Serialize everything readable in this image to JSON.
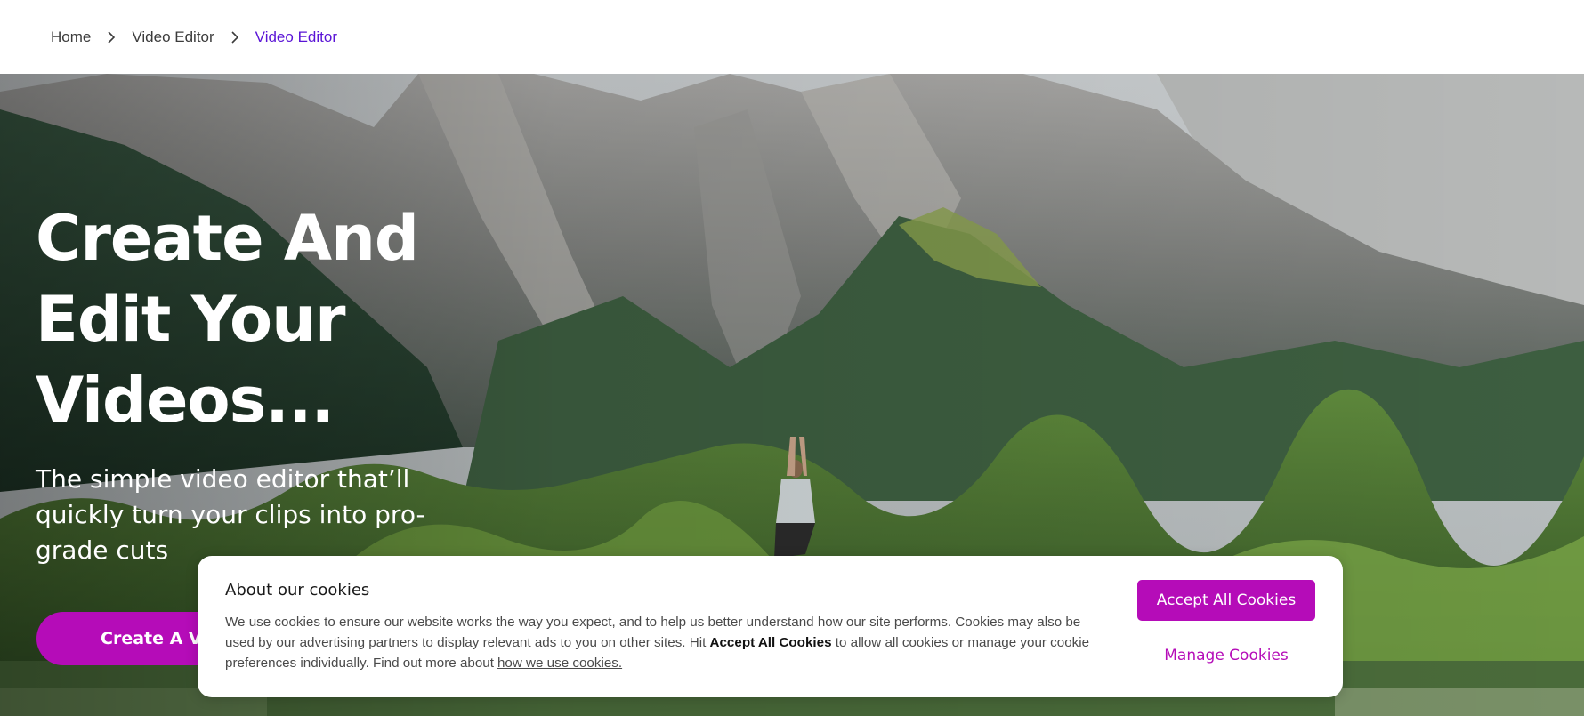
{
  "breadcrumb": {
    "items": [
      "Home",
      "Video Editor",
      "Video Editor"
    ],
    "separator_icon": "chevron-right-icon"
  },
  "hero": {
    "title": "Create And Edit Your Videos...",
    "subtitle": "The simple video editor that’ll quickly turn your clips into pro-grade cuts",
    "cta_label": "Create A Video"
  },
  "cookies": {
    "title": "About our cookies",
    "text_part1": "We use cookies to ensure our website works the way you expect, and to help us better understand how our site performs. Cookies may also be used by our advertising partners to display relevant ads to you on other sites. Hit ",
    "text_bold": "Accept All Cookies",
    "text_part2": " to allow all cookies or manage your cookie preferences individually. Find out more about",
    "link_label": "how we use cookies.",
    "accept_label": "Accept All Cookies",
    "manage_label": "Manage Cookies"
  },
  "colors": {
    "accent": "#b50cb8",
    "breadcrumb_current": "#5a14d6"
  }
}
